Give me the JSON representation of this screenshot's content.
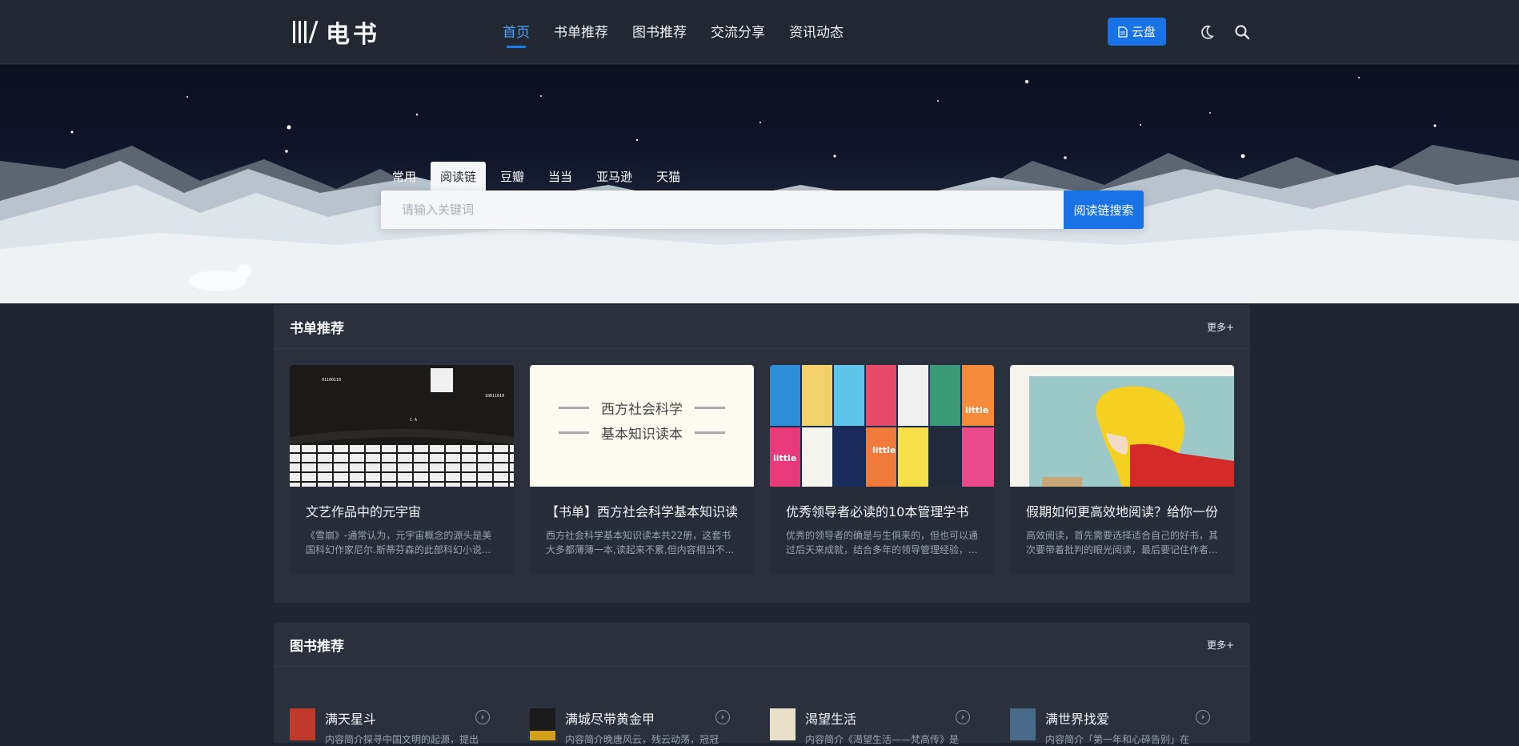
{
  "header": {
    "logo_text": "电书",
    "nav": [
      "首页",
      "书单推荐",
      "图书推荐",
      "交流分享",
      "资讯动态"
    ],
    "active_nav": "首页",
    "cloud_button": "云盘"
  },
  "search": {
    "tabs": [
      "常用",
      "阅读链",
      "豆瓣",
      "当当",
      "亚马逊",
      "天猫"
    ],
    "active_tab": "阅读链",
    "placeholder": "请输入关键词",
    "button": "阅读链搜索"
  },
  "booklists": {
    "title": "书单推荐",
    "more": "更多+",
    "cards": [
      {
        "title": "文艺作品中的元宇宙",
        "desc": "《雪崩》-通常认为，元宇宙概念的源头是美国科幻作家尼尔.斯蒂芬森的此部科幻小说..."
      },
      {
        "title": "【书单】西方社会科学基本知识读",
        "desc": "西方社会科学基本知识读本共22册，这套书大多都薄薄一本,读起来不累,但内容相当不...",
        "cover_line1": "西方社会科学",
        "cover_line2": "基本知识读本"
      },
      {
        "title": "优秀领导者必读的10本管理学书",
        "desc": "优秀的领导者的确是与生俱来的，但也可以通过后天来成就，结合多年的领导管理经验，..."
      },
      {
        "title": "假期如何更高效地阅读？给你一份",
        "desc": "高效阅读，首先需要选择适合自己的好书，其次要带着批判的眼光阅读，最后要记住作者..."
      }
    ]
  },
  "books": {
    "title": "图书推荐",
    "more": "更多+",
    "items": [
      {
        "title": "满天星斗",
        "desc": "内容简介探寻中国文明的起源，提出",
        "arrow": "›",
        "thumb_color": "#c0392b"
      },
      {
        "title": "满城尽带黄金甲",
        "desc": "内容简介晚唐风云，残云动荡，冠冠",
        "arrow": "›",
        "thumb_color": "#d4a017"
      },
      {
        "title": "渴望生活",
        "desc": "内容简介《渴望生活——梵高传》是",
        "arrow": "›",
        "thumb_color": "#e8e0c8"
      },
      {
        "title": "满世界找爱",
        "desc": "内容简介「第一年和心碎告别」在",
        "arrow": "›",
        "thumb_color": "#4a6a8a"
      }
    ]
  }
}
